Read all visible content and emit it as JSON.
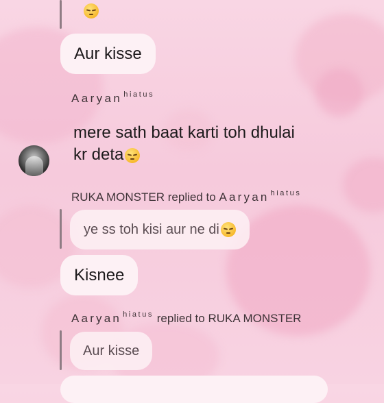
{
  "messages": {
    "emoji_only": {
      "emoji": "pensive-face-emoji"
    },
    "m1": {
      "text": "Aur kisse"
    },
    "sender_block": {
      "name": "Aaryan",
      "tag": "hiatus",
      "line1": "mere sath baat karti toh dhulai",
      "line2": "kr deta",
      "emoji": "pensive-face-emoji"
    },
    "reply1": {
      "from": "RUKA MONSTER",
      "replied_to_text": "replied to",
      "to_name": "Aaryan",
      "to_tag": "hiatus",
      "quoted": "ye ss toh kisi aur ne di",
      "emoji": "pensive-face-emoji"
    },
    "m2": {
      "text": "Kisnee"
    },
    "reply2": {
      "from_name": "Aaryan",
      "from_tag": "hiatus",
      "replied_to_text": "replied to",
      "to": "RUKA MONSTER",
      "quoted": "Aur kisse"
    }
  },
  "theme": {
    "bubble": "#fdf1f5",
    "background": "#f8d3e2",
    "heart": "#f2b5cb"
  }
}
